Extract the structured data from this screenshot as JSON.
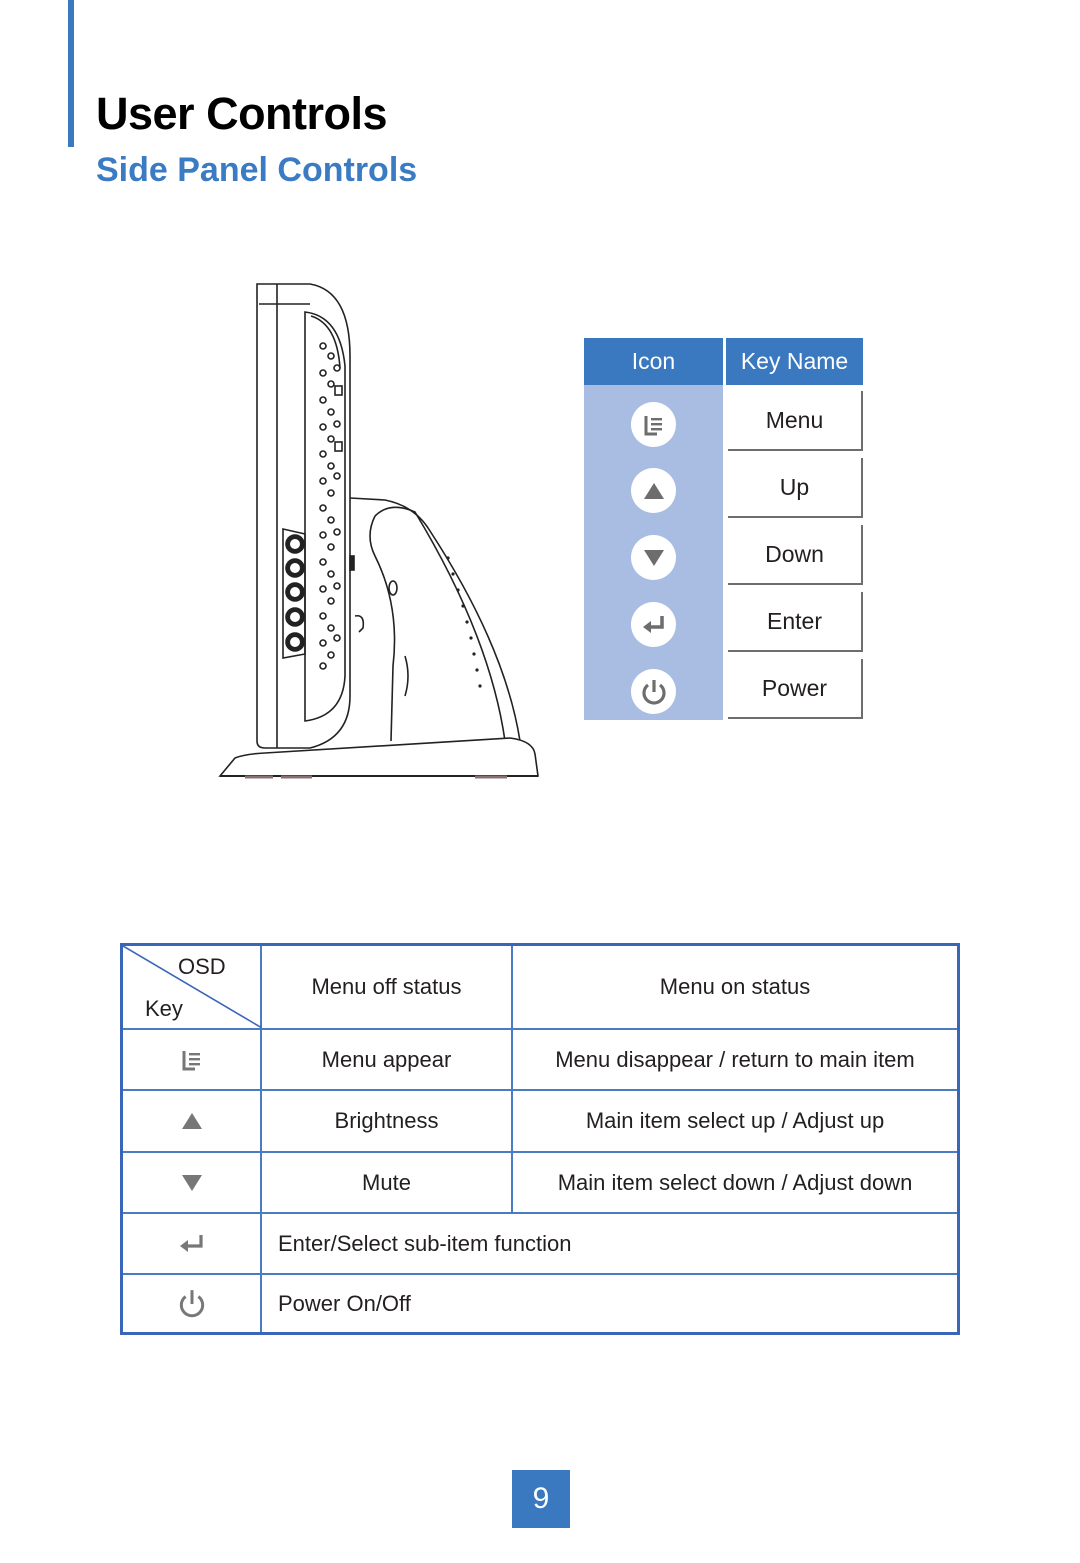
{
  "header": {
    "title": "User Controls",
    "subtitle": "Side Panel Controls"
  },
  "key_legend": {
    "headers": {
      "icon": "Icon",
      "key_name": "Key Name"
    },
    "keys": [
      {
        "icon": "menu-icon",
        "name": "Menu"
      },
      {
        "icon": "up-arrow-icon",
        "name": "Up"
      },
      {
        "icon": "down-arrow-icon",
        "name": "Down"
      },
      {
        "icon": "enter-icon",
        "name": "Enter"
      },
      {
        "icon": "power-icon",
        "name": "Power"
      }
    ]
  },
  "osd_table": {
    "corner": {
      "top": "OSD",
      "bottom": "Key"
    },
    "headers": {
      "menu_off": "Menu off status",
      "menu_on": "Menu on status"
    },
    "rows": [
      {
        "icon": "menu-icon",
        "menu_off": "Menu appear",
        "menu_on": "Menu disappear / return to main item"
      },
      {
        "icon": "up-arrow-icon",
        "menu_off": "Brightness",
        "menu_on": "Main item select up / Adjust up"
      },
      {
        "icon": "down-arrow-icon",
        "menu_off": "Mute",
        "menu_on": "Main item select down / Adjust down"
      },
      {
        "icon": "enter-icon",
        "combined": "Enter/Select sub-item function"
      },
      {
        "icon": "power-icon",
        "combined": "Power On/Off"
      }
    ]
  },
  "colors": {
    "accent_blue": "#3a78bf",
    "legend_icon_bg": "#a9bde3",
    "icon_gray": "#6d6d6d"
  },
  "page_number": "9"
}
